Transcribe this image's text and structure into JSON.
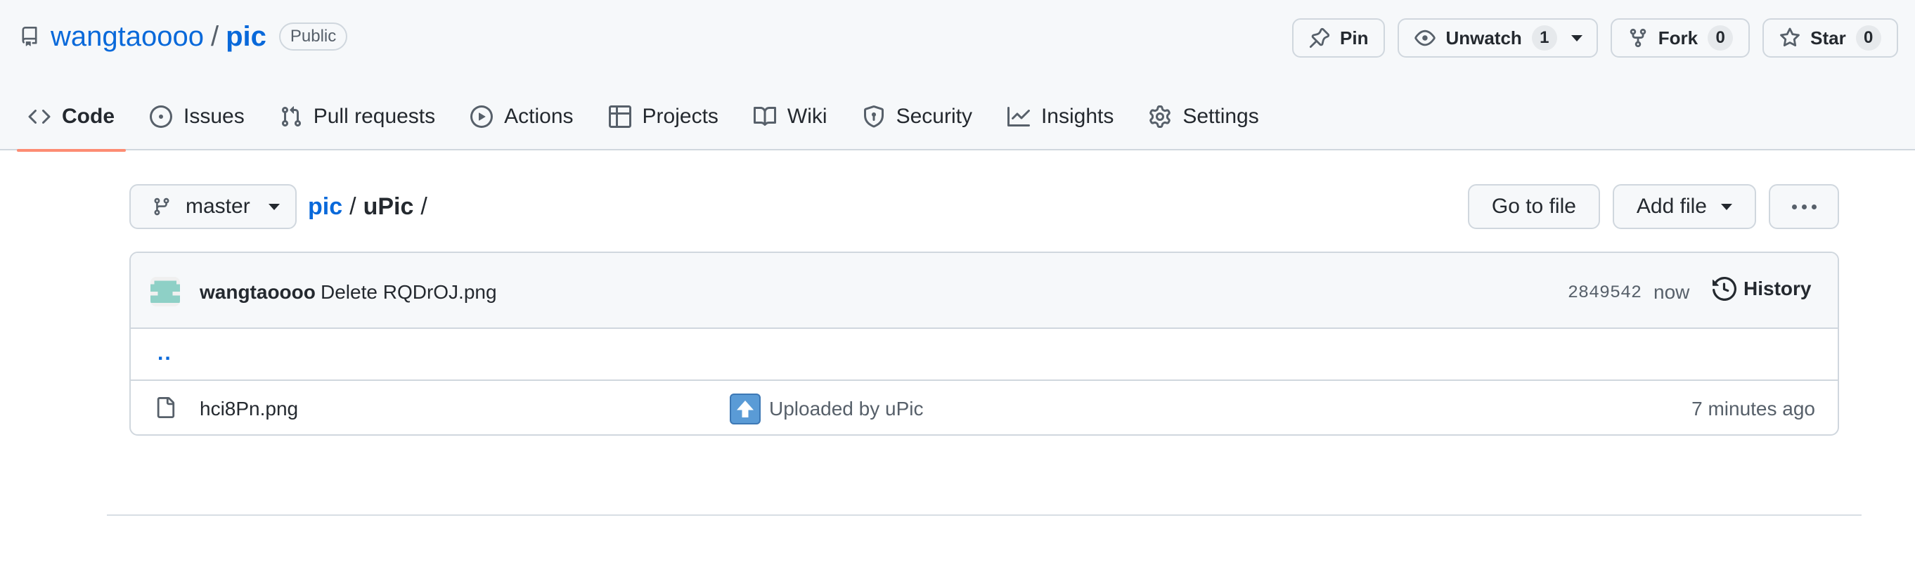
{
  "repo": {
    "owner": "wangtaoooo",
    "separator": "/",
    "name": "pic",
    "visibility": "Public"
  },
  "header_actions": {
    "pin": {
      "label": "Pin",
      "icon": "pin-icon"
    },
    "watch": {
      "label": "Unwatch",
      "count": "1",
      "icon": "eye-icon"
    },
    "fork": {
      "label": "Fork",
      "count": "0",
      "icon": "fork-icon"
    },
    "star": {
      "label": "Star",
      "count": "0",
      "icon": "star-icon"
    }
  },
  "tabs": [
    {
      "label": "Code",
      "icon": "code-icon",
      "selected": true
    },
    {
      "label": "Issues",
      "icon": "issue-icon"
    },
    {
      "label": "Pull requests",
      "icon": "pull-request-icon"
    },
    {
      "label": "Actions",
      "icon": "play-icon"
    },
    {
      "label": "Projects",
      "icon": "table-icon"
    },
    {
      "label": "Wiki",
      "icon": "book-icon"
    },
    {
      "label": "Security",
      "icon": "shield-icon"
    },
    {
      "label": "Insights",
      "icon": "graph-icon"
    },
    {
      "label": "Settings",
      "icon": "gear-icon"
    }
  ],
  "branch": {
    "name": "master",
    "icon": "branch-icon"
  },
  "breadcrumb": {
    "root": "pic",
    "sep1": "/",
    "current": "uPic",
    "sep2": "/"
  },
  "file_actions": {
    "go_to_file": "Go to file",
    "add_file": "Add file"
  },
  "latest_commit": {
    "author": "wangtaoooo",
    "message": "Delete RQDrOJ.png",
    "sha": "2849542",
    "time": "now",
    "history_label": "History"
  },
  "parent_dir": "..",
  "files": [
    {
      "name": "hci8Pn.png",
      "commit_message": "Uploaded by uPic",
      "age": "7 minutes ago",
      "icon": "file-icon"
    }
  ],
  "colors": {
    "link": "#0969da",
    "selected_tab_underline": "#fd8c73",
    "header_bg": "#f6f8fa",
    "border": "#d0d7de"
  }
}
